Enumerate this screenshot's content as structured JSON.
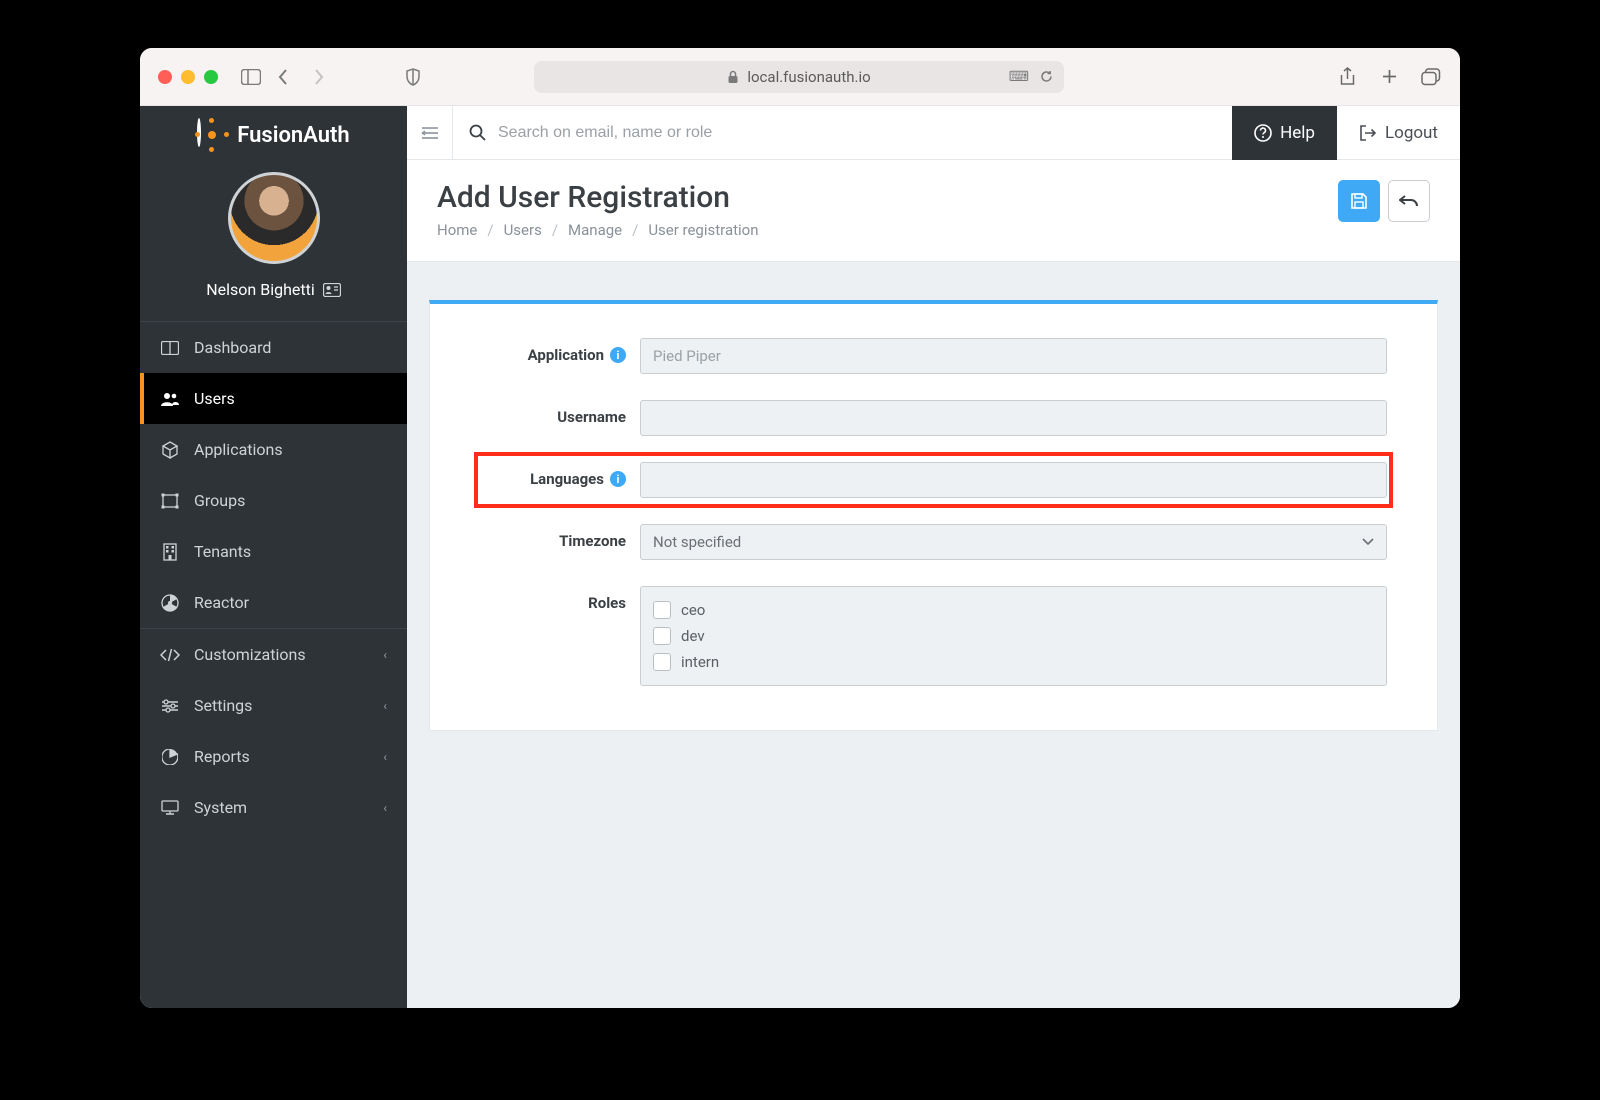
{
  "browser": {
    "url": "local.fusionauth.io"
  },
  "brand": {
    "name": "FusionAuth"
  },
  "profile": {
    "name": "Nelson Bighetti"
  },
  "sidebar": {
    "items": [
      {
        "label": "Dashboard"
      },
      {
        "label": "Users"
      },
      {
        "label": "Applications"
      },
      {
        "label": "Groups"
      },
      {
        "label": "Tenants"
      },
      {
        "label": "Reactor"
      },
      {
        "label": "Customizations"
      },
      {
        "label": "Settings"
      },
      {
        "label": "Reports"
      },
      {
        "label": "System"
      }
    ]
  },
  "topbar": {
    "search_placeholder": "Search on email, name or role",
    "help_label": "Help",
    "logout_label": "Logout"
  },
  "page": {
    "title": "Add User Registration",
    "breadcrumb": [
      "Home",
      "Users",
      "Manage",
      "User registration"
    ]
  },
  "form": {
    "application_label": "Application",
    "application_value": "Pied Piper",
    "username_label": "Username",
    "username_value": "",
    "languages_label": "Languages",
    "languages_value": "",
    "timezone_label": "Timezone",
    "timezone_value": "Not specified",
    "roles_label": "Roles",
    "roles": [
      "ceo",
      "dev",
      "intern"
    ]
  }
}
